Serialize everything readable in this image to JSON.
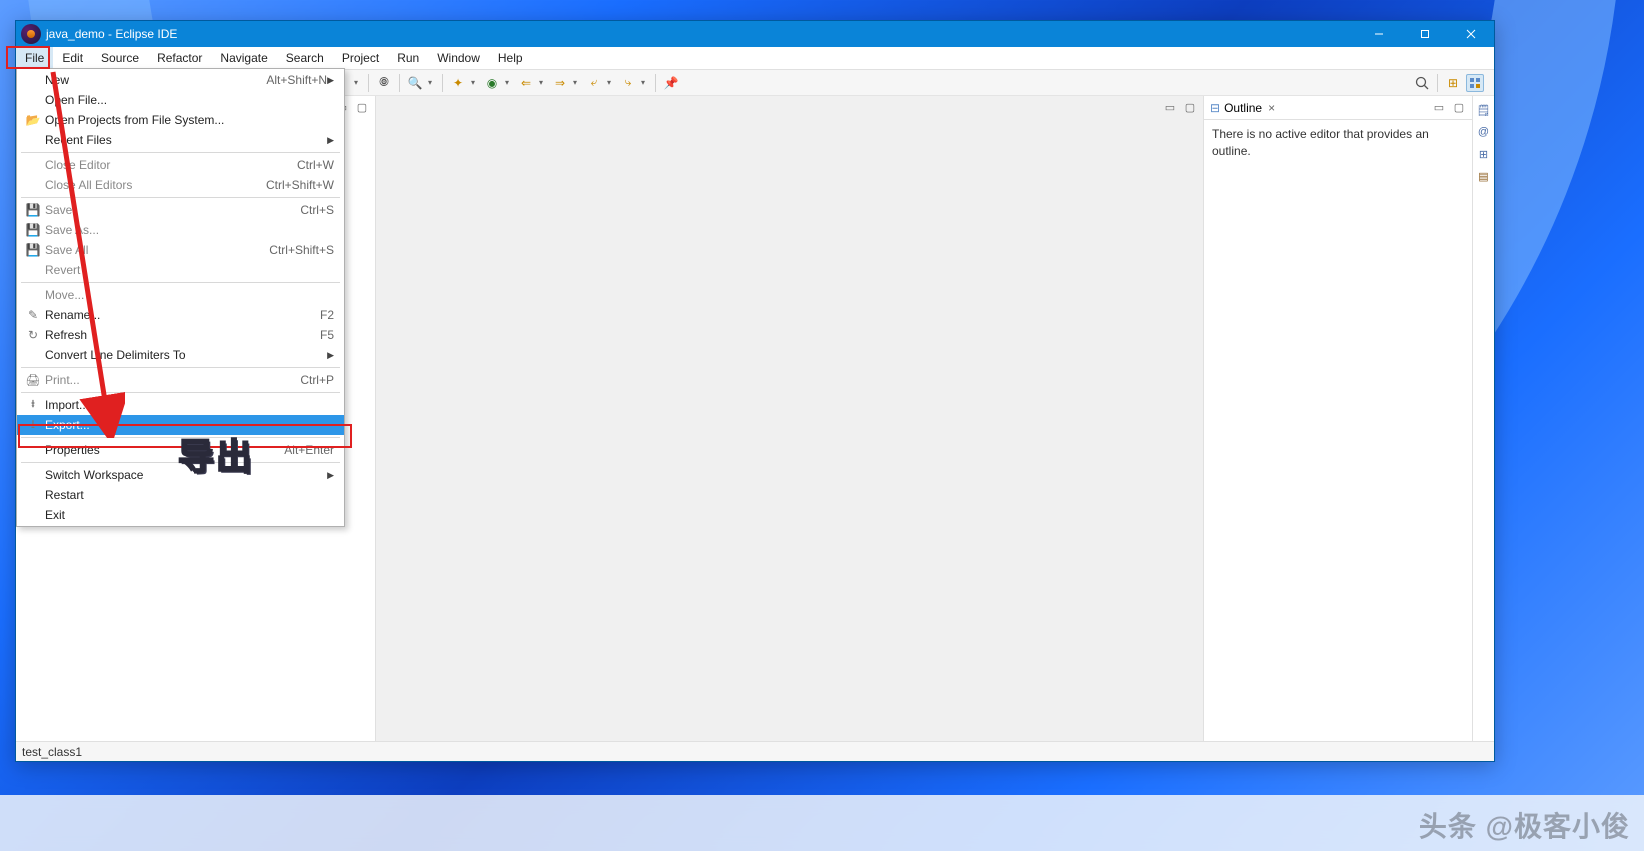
{
  "titlebar": {
    "title": "java_demo - Eclipse IDE"
  },
  "menubar": [
    "File",
    "Edit",
    "Source",
    "Refactor",
    "Navigate",
    "Search",
    "Project",
    "Run",
    "Window",
    "Help"
  ],
  "file_menu": [
    {
      "type": "item",
      "label": "New",
      "shortcut": "Alt+Shift+N",
      "submenu": true,
      "icon": ""
    },
    {
      "type": "item",
      "label": "Open File...",
      "icon": ""
    },
    {
      "type": "item",
      "label": "Open Projects from File System...",
      "icon": "folder"
    },
    {
      "type": "item",
      "label": "Recent Files",
      "submenu": true,
      "icon": ""
    },
    {
      "type": "sep"
    },
    {
      "type": "item",
      "label": "Close Editor",
      "shortcut": "Ctrl+W",
      "disabled": true,
      "icon": ""
    },
    {
      "type": "item",
      "label": "Close All Editors",
      "shortcut": "Ctrl+Shift+W",
      "disabled": true,
      "icon": ""
    },
    {
      "type": "sep"
    },
    {
      "type": "item",
      "label": "Save",
      "shortcut": "Ctrl+S",
      "disabled": true,
      "icon": "save"
    },
    {
      "type": "item",
      "label": "Save As...",
      "disabled": true,
      "icon": "save"
    },
    {
      "type": "item",
      "label": "Save All",
      "shortcut": "Ctrl+Shift+S",
      "disabled": true,
      "icon": "saveall"
    },
    {
      "type": "item",
      "label": "Revert",
      "disabled": true,
      "icon": ""
    },
    {
      "type": "sep"
    },
    {
      "type": "item",
      "label": "Move...",
      "disabled": true,
      "icon": ""
    },
    {
      "type": "item",
      "label": "Rename...",
      "shortcut": "F2",
      "icon": "rename"
    },
    {
      "type": "item",
      "label": "Refresh",
      "shortcut": "F5",
      "icon": "refresh"
    },
    {
      "type": "item",
      "label": "Convert Line Delimiters To",
      "submenu": true,
      "icon": ""
    },
    {
      "type": "sep"
    },
    {
      "type": "item",
      "label": "Print...",
      "shortcut": "Ctrl+P",
      "disabled": true,
      "icon": "print"
    },
    {
      "type": "sep"
    },
    {
      "type": "item",
      "label": "Import...",
      "icon": "import"
    },
    {
      "type": "item",
      "label": "Export...",
      "hover": true,
      "icon": "export"
    },
    {
      "type": "sep"
    },
    {
      "type": "item",
      "label": "Properties",
      "shortcut": "Alt+Enter",
      "icon": ""
    },
    {
      "type": "sep"
    },
    {
      "type": "item",
      "label": "Switch Workspace",
      "submenu": true,
      "icon": ""
    },
    {
      "type": "item",
      "label": "Restart",
      "icon": ""
    },
    {
      "type": "item",
      "label": "Exit",
      "icon": ""
    }
  ],
  "outline": {
    "tab_label": "Outline",
    "message": "There is no active editor that provides an outline."
  },
  "statusbar": {
    "text": "test_class1"
  },
  "annotation": {
    "label": "导出"
  },
  "watermark": "头条 @极客小俊"
}
